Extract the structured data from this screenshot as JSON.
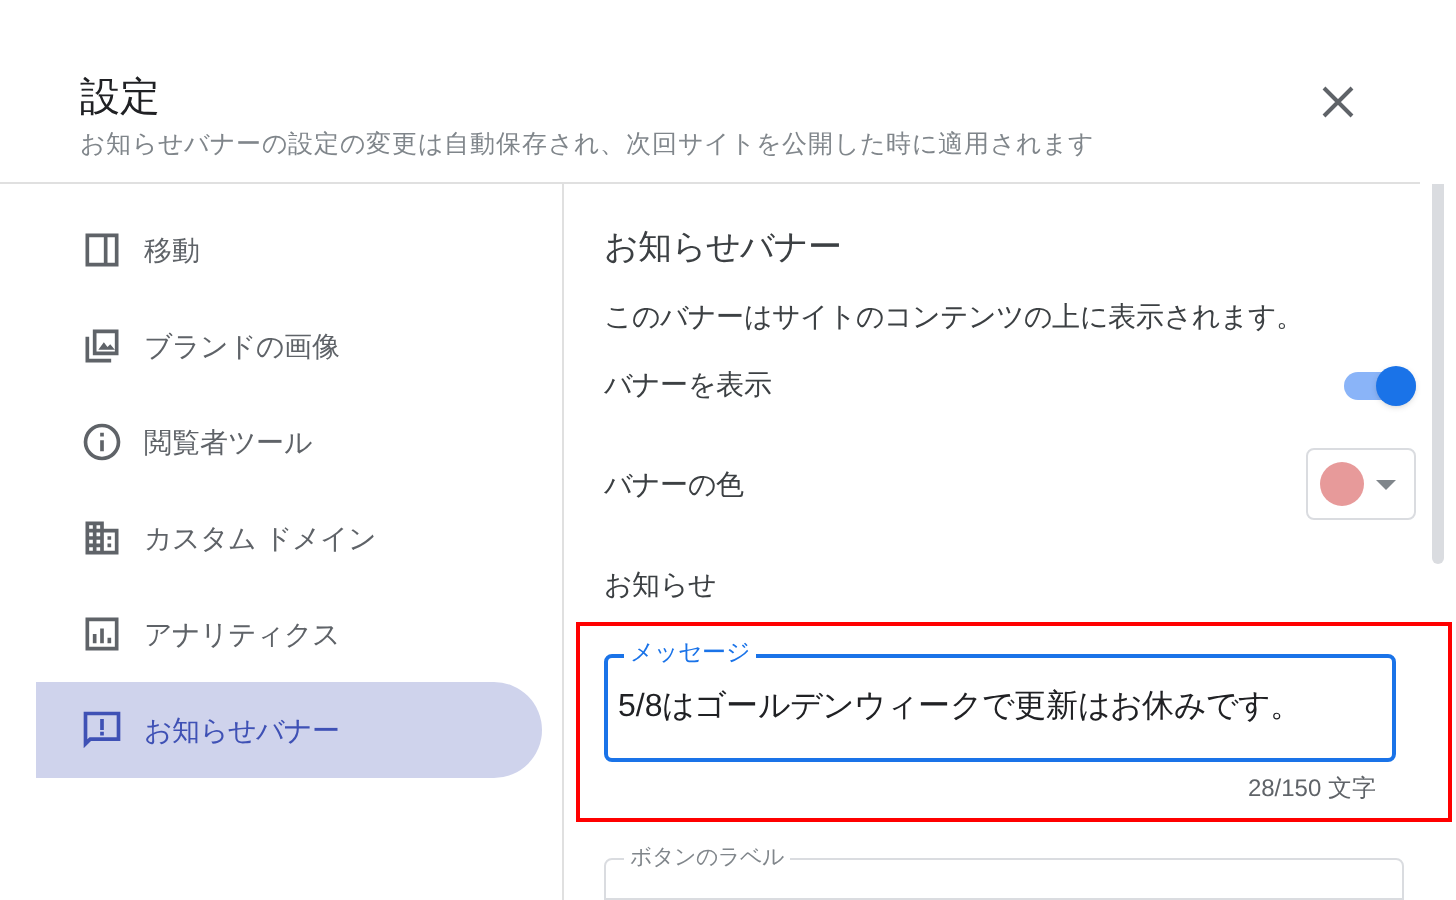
{
  "dialog": {
    "title": "設定",
    "subtitle": "お知らせバナーの設定の変更は自動保存され、次回サイトを公開した時に適用されます"
  },
  "sidebar": {
    "items": [
      {
        "label": "移動",
        "selected": false
      },
      {
        "label": "ブランドの画像",
        "selected": false
      },
      {
        "label": "閲覧者ツール",
        "selected": false
      },
      {
        "label": "カスタム ドメイン",
        "selected": false
      },
      {
        "label": "アナリティクス",
        "selected": false
      },
      {
        "label": "お知らせバナー",
        "selected": true
      }
    ]
  },
  "panel": {
    "heading": "お知らせバナー",
    "description": "このバナーはサイトのコンテンツの上に表示されます。",
    "show_banner": {
      "label": "バナーを表示",
      "on": true
    },
    "banner_color": {
      "label": "バナーの色",
      "color": "#e79a9a"
    },
    "notice_label": "お知らせ",
    "message": {
      "label": "メッセージ",
      "value": "5/8はゴールデンウィークで更新はお休みです。",
      "counter": "28/150 文字",
      "highlighted": true
    },
    "button_label": {
      "label": "ボタンのラベル"
    }
  }
}
